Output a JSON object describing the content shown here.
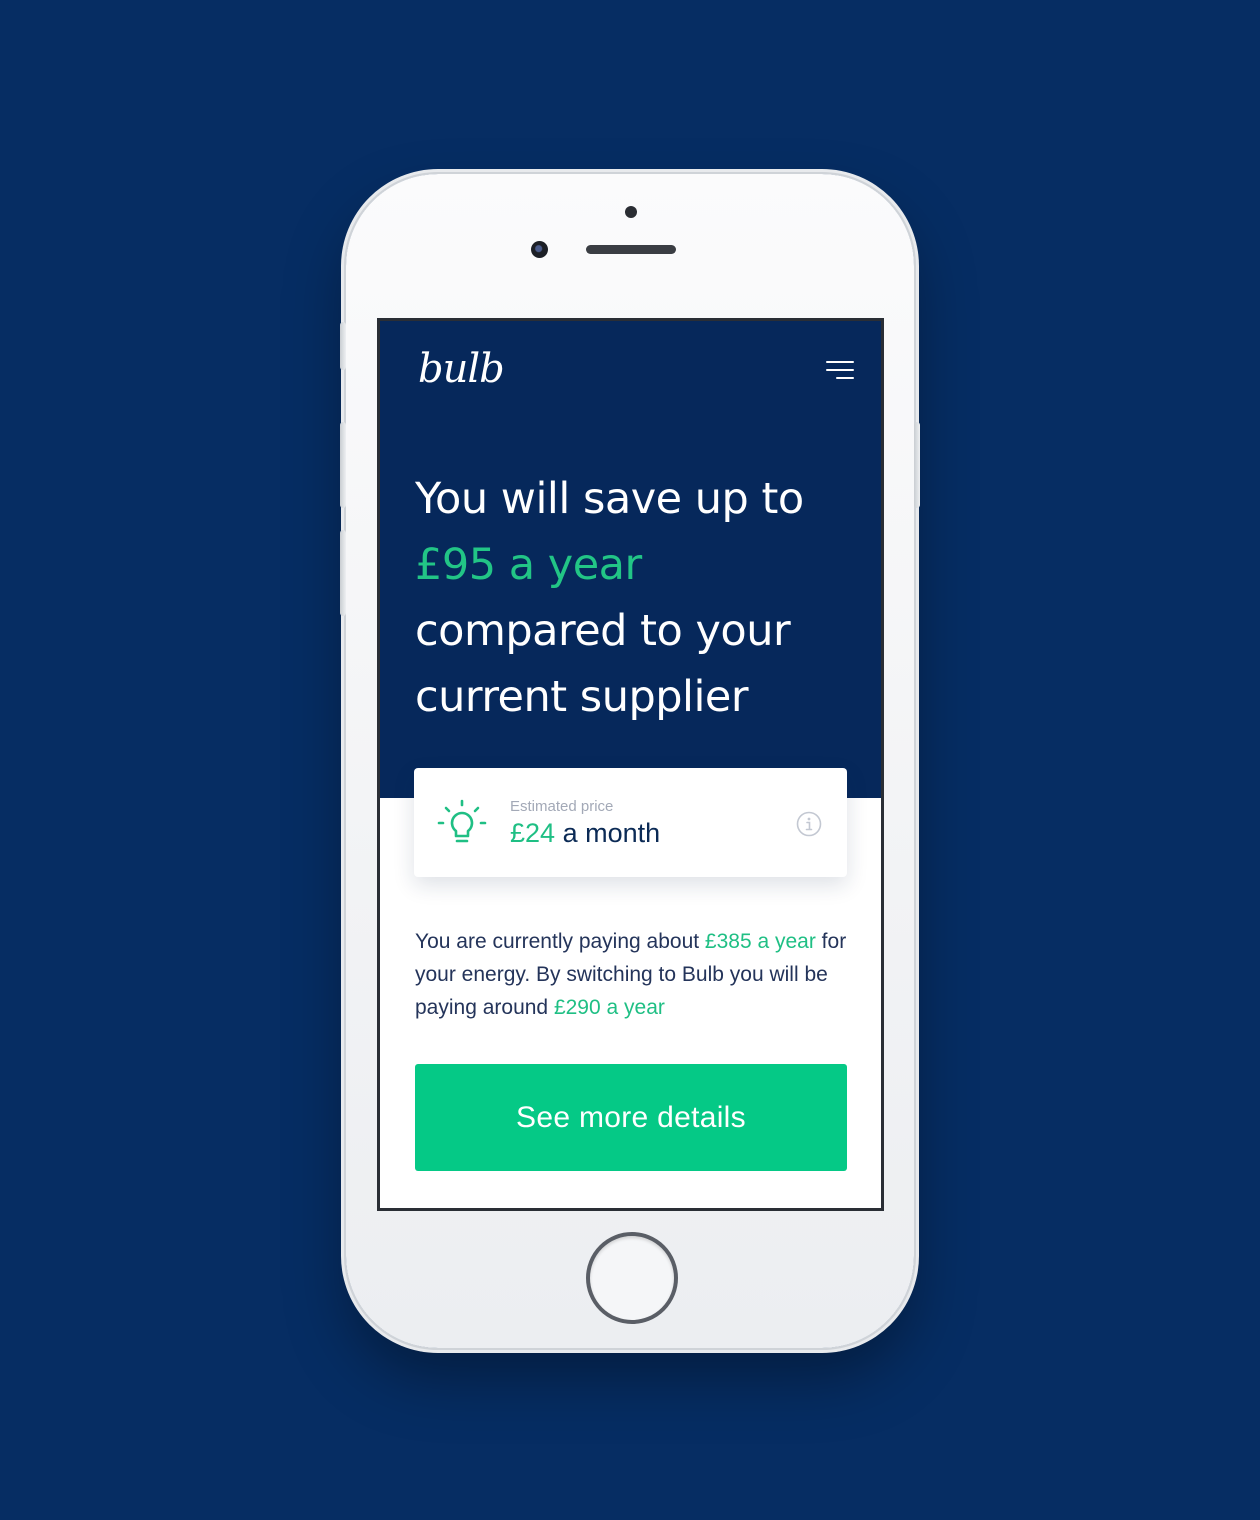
{
  "app": {
    "logo_text": "bulb"
  },
  "colors": {
    "background": "#062d63",
    "hero": "#06285b",
    "accent_green": "#05c986",
    "text_dark": "#24345a"
  },
  "header": {
    "menu_icon": "hamburger-menu-icon"
  },
  "hero": {
    "line1": "You will save up to",
    "highlight": "£95 a year",
    "line3": "compared to your",
    "line4": "current supplier"
  },
  "price_card": {
    "icon": "lightbulb-icon",
    "caption": "Estimated price",
    "amount": "£24",
    "period": " a month",
    "info_icon": "info-icon"
  },
  "summary": {
    "part1": "You are currently paying about ",
    "current_cost": "£385 a year",
    "part2": " for your energy. By switching to Bulb you will be paying around ",
    "new_cost": "£290 a year"
  },
  "cta": {
    "label": "See more details"
  }
}
